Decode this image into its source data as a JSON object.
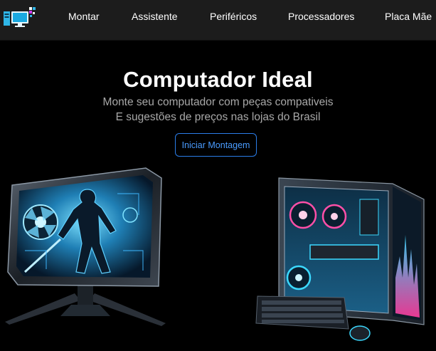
{
  "nav": {
    "items": [
      "Montar",
      "Assistente",
      "Periféricos",
      "Processadores",
      "Placa Mãe"
    ]
  },
  "hero": {
    "title": "Computador Ideal",
    "subtitle_line1": "Monte seu computador com peças compativeis",
    "subtitle_line2": "E sugestões de preços nas lojas do Brasil",
    "cta_label": "Iniciar Montagem"
  },
  "icons": {
    "logo": "pc-monitor-logo-icon"
  },
  "colors": {
    "navbar_bg": "#1c1c1c",
    "page_bg": "#000000",
    "accent": "#2b7de9",
    "neon_cyan": "#33d6ff",
    "neon_pink": "#ff3c9e"
  }
}
